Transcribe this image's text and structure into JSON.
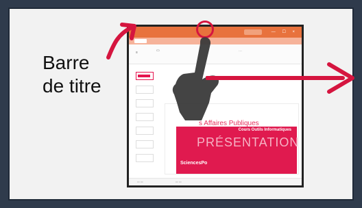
{
  "caption": {
    "line1": "Barre",
    "line2": "de titre"
  },
  "screenshot": {
    "slide_heading": "s Affaires Publiques",
    "slide_course": "Cours Outils Informatiques",
    "slide_title": "PRÉSENTATION",
    "slide_brand": "SciencesPo"
  },
  "colors": {
    "accent": "#e01a4f",
    "titlebar": "#e8723d"
  },
  "icons": {
    "pointer": "pointing-hand-icon",
    "arrow": "arrow-icon"
  }
}
